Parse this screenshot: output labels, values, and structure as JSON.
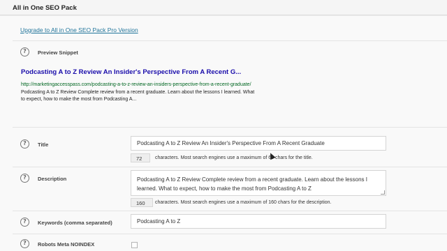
{
  "metabox": {
    "title": "All in One SEO Pack"
  },
  "upgrade_link": "Upgrade to All in One SEO Pack Pro Version",
  "preview": {
    "label": "Preview Snippet",
    "title": "Podcasting A to Z Review An Insider's Perspective From A Recent G...",
    "url": "http://marketingaccesspass.com/podcasting-a-to-z-review-an-insiders-perspective-from-a-recent-graduate/",
    "description": "Podcasting A to Z Review Complete review from a recent graduate. Learn about the lessons I learned. What to expect, how to make the most from Podcasting A..."
  },
  "title_field": {
    "label": "Title",
    "value": "Podcasting A to Z Review An Insider's Perspective From A Recent Graduate",
    "count": "72",
    "count_text": "characters. Most search engines use a maximum of 60 chars for the title."
  },
  "description_field": {
    "label": "Description",
    "value": "Podcasting A to Z Review  Complete review from a recent graduate. Learn about the lessons I learned. What to expect, how to make the most from Podcasting A to Z",
    "count": "160",
    "count_text": "characters. Most search engines use a maximum of 160 chars for the description."
  },
  "keywords_field": {
    "label": "Keywords (comma separated)",
    "value": "Podcasting A to Z"
  },
  "noindex_field": {
    "label": "Robots Meta NOINDEX",
    "checked": false
  },
  "help_icon_glyph": "?"
}
